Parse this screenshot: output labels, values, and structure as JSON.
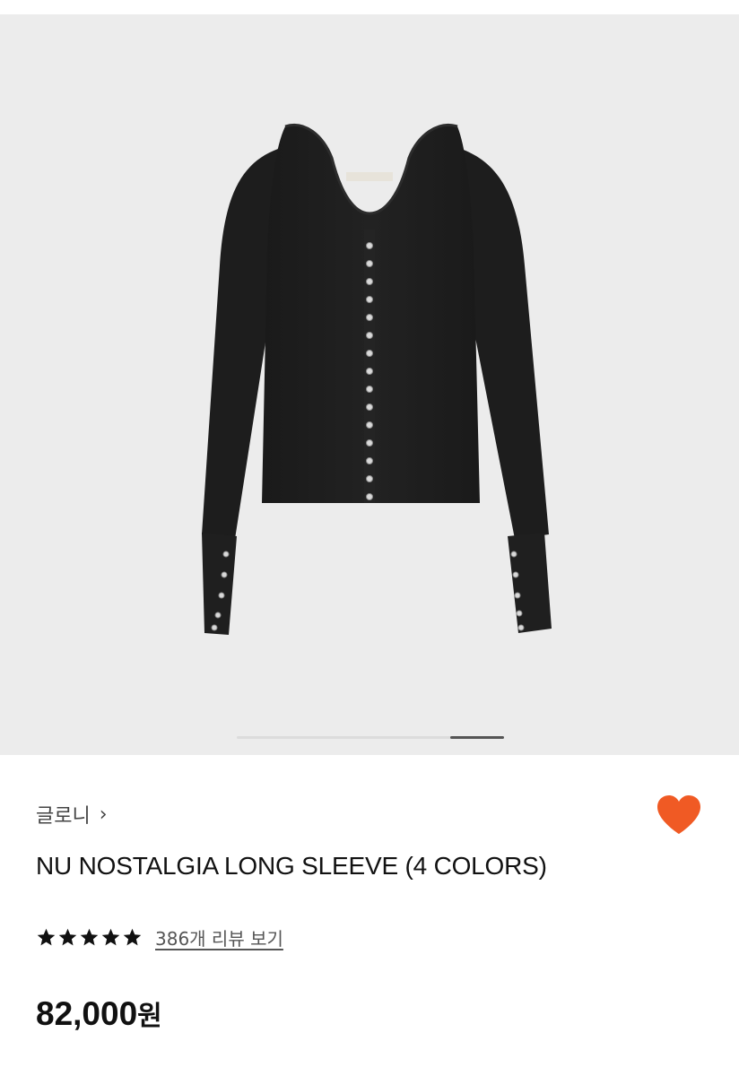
{
  "gallery": {
    "image_alt": "Black long sleeve knit top with metal snap buttons",
    "active_slide": 2,
    "total_slides": 2
  },
  "product": {
    "brand": "글로니",
    "title": "NU NOSTALGIA LONG SLEEVE (4 COLORS)",
    "rating": 5,
    "max_rating": 5,
    "reviews_link": "386개 리뷰 보기",
    "price": "82,000",
    "currency_unit": "원",
    "wishlisted": true
  },
  "icons": {
    "brand_chevron": "chevron-right-icon",
    "wishlist": "heart-icon",
    "rating": "star-icon"
  },
  "colors": {
    "heart": "#f05a24",
    "gallery_bg": "#ececec",
    "garment": "#1c1c1c"
  }
}
